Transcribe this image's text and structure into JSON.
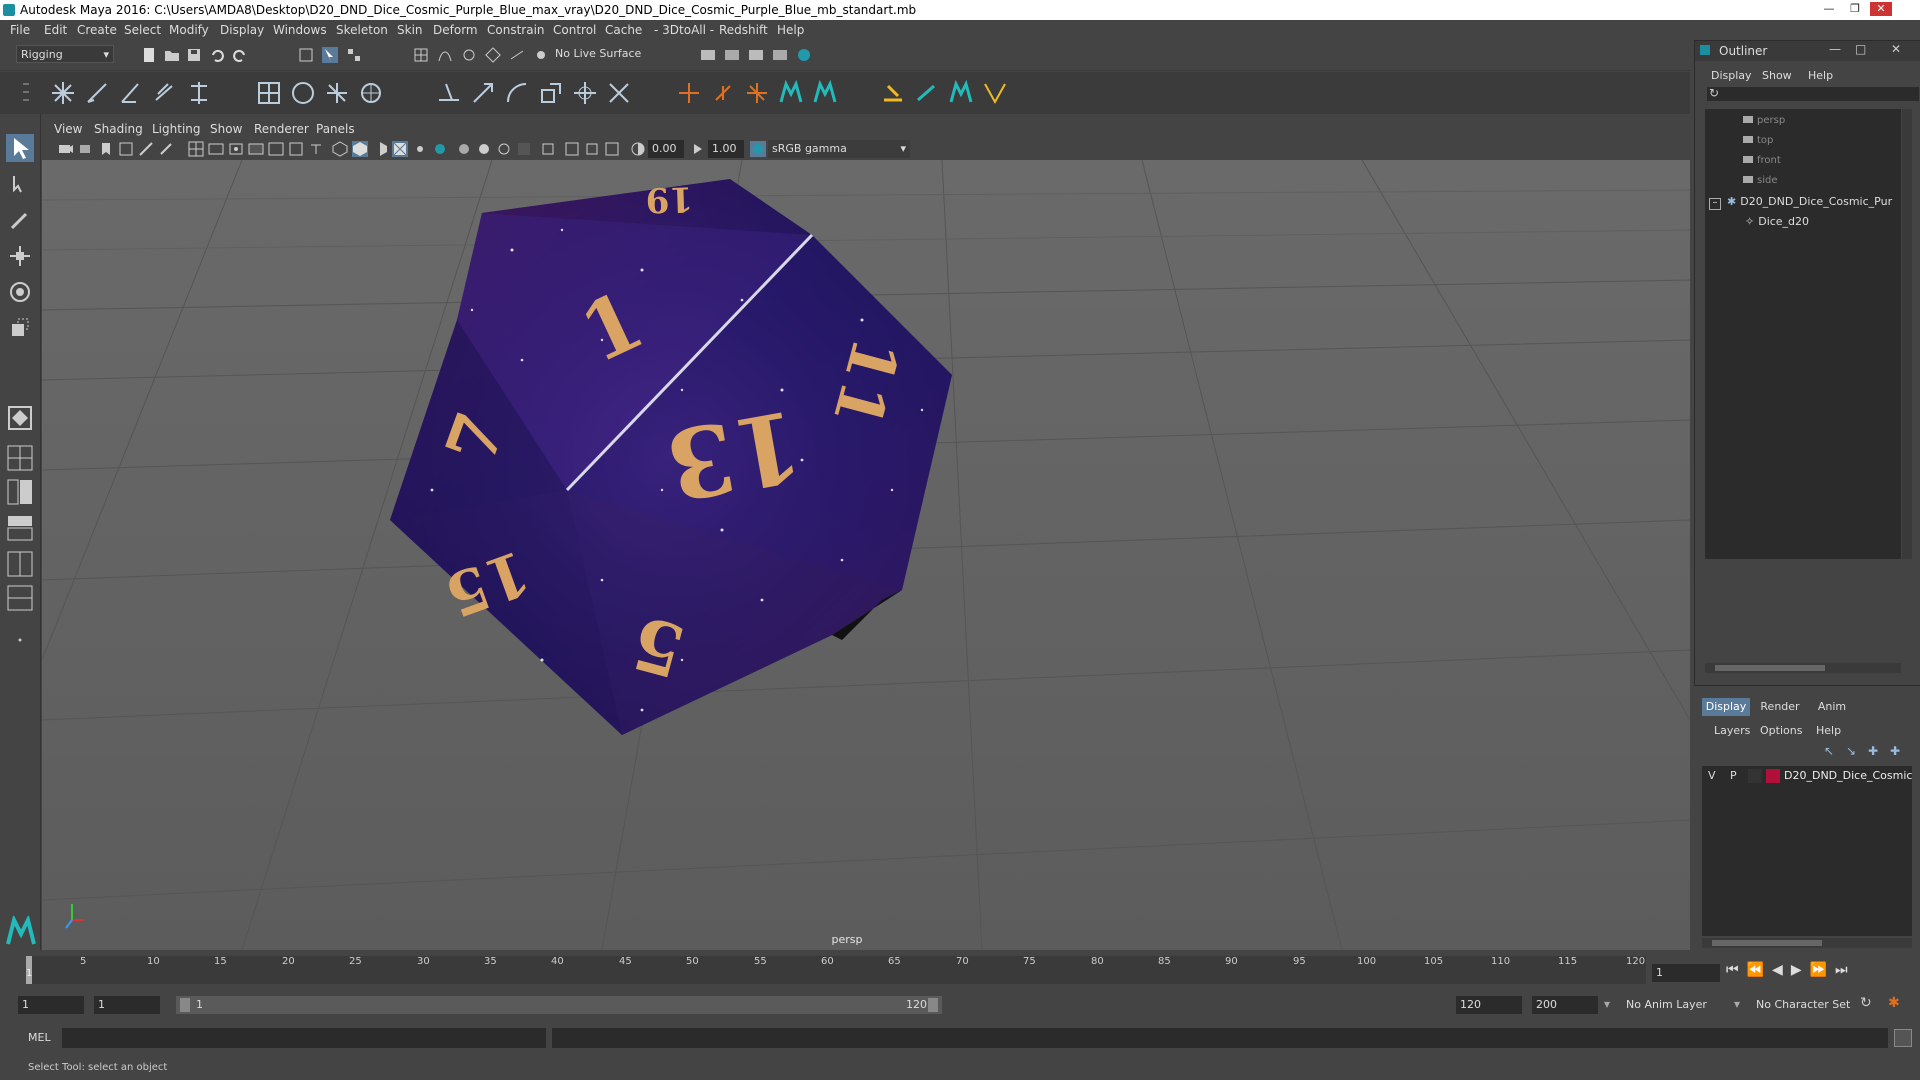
{
  "window": {
    "title": "Autodesk Maya 2016: C:\\Users\\AMDA8\\Desktop\\D20_DND_Dice_Cosmic_Purple_Blue_max_vray\\D20_DND_Dice_Cosmic_Purple_Blue_mb_standart.mb"
  },
  "menu": [
    "File",
    "Edit",
    "Create",
    "Select",
    "Modify",
    "Display",
    "Windows",
    "Skeleton",
    "Skin",
    "Deform",
    "Constrain",
    "Control",
    "Cache",
    "- 3DtoAll -",
    "Redshift",
    "Help"
  ],
  "toolbar": {
    "mode": "Rigging",
    "live_surface": "No Live Surface"
  },
  "viewport": {
    "menu": [
      "View",
      "Shading",
      "Lighting",
      "Show",
      "Renderer",
      "Panels"
    ],
    "field1": "0.00",
    "field2": "1.00",
    "colorspace": "sRGB gamma",
    "camera_label": "persp",
    "dice_numbers": [
      "19",
      "1",
      "13",
      "11",
      "7",
      "15",
      "5"
    ]
  },
  "outliner": {
    "title": "Outliner",
    "menu": [
      "Display",
      "Show",
      "Help"
    ],
    "items": [
      {
        "label": "persp"
      },
      {
        "label": "top"
      },
      {
        "label": "front"
      },
      {
        "label": "side"
      },
      {
        "label": "D20_DND_Dice_Cosmic_Pur"
      },
      {
        "label": "Dice_d20"
      }
    ]
  },
  "layers": {
    "tabs": [
      "Display",
      "Render",
      "Anim"
    ],
    "menu": [
      "Layers",
      "Options",
      "Help"
    ],
    "row": {
      "v": "V",
      "p": "P",
      "name": "D20_DND_Dice_Cosmic",
      "color": "#b0103a"
    }
  },
  "timeline": {
    "ticks": [
      "1",
      "5",
      "10",
      "15",
      "20",
      "25",
      "30",
      "35",
      "40",
      "45",
      "50",
      "55",
      "60",
      "65",
      "70",
      "75",
      "80",
      "85",
      "90",
      "95",
      "100",
      "105",
      "110",
      "115",
      "120"
    ],
    "current_frame": "1"
  },
  "range": {
    "start": "1",
    "start2": "1",
    "slider_start": "1",
    "slider_end": "120",
    "end": "120",
    "end2": "200",
    "anim_layer": "No Anim Layer",
    "char_set": "No Character Set"
  },
  "cmd": {
    "label": "MEL"
  },
  "help": {
    "text": "Select Tool: select an object"
  },
  "colors": {
    "ui_bg": "#444444",
    "viewport": "#636363",
    "dice_purple": "#2c1b6a",
    "number_gold": "#d9a463"
  }
}
